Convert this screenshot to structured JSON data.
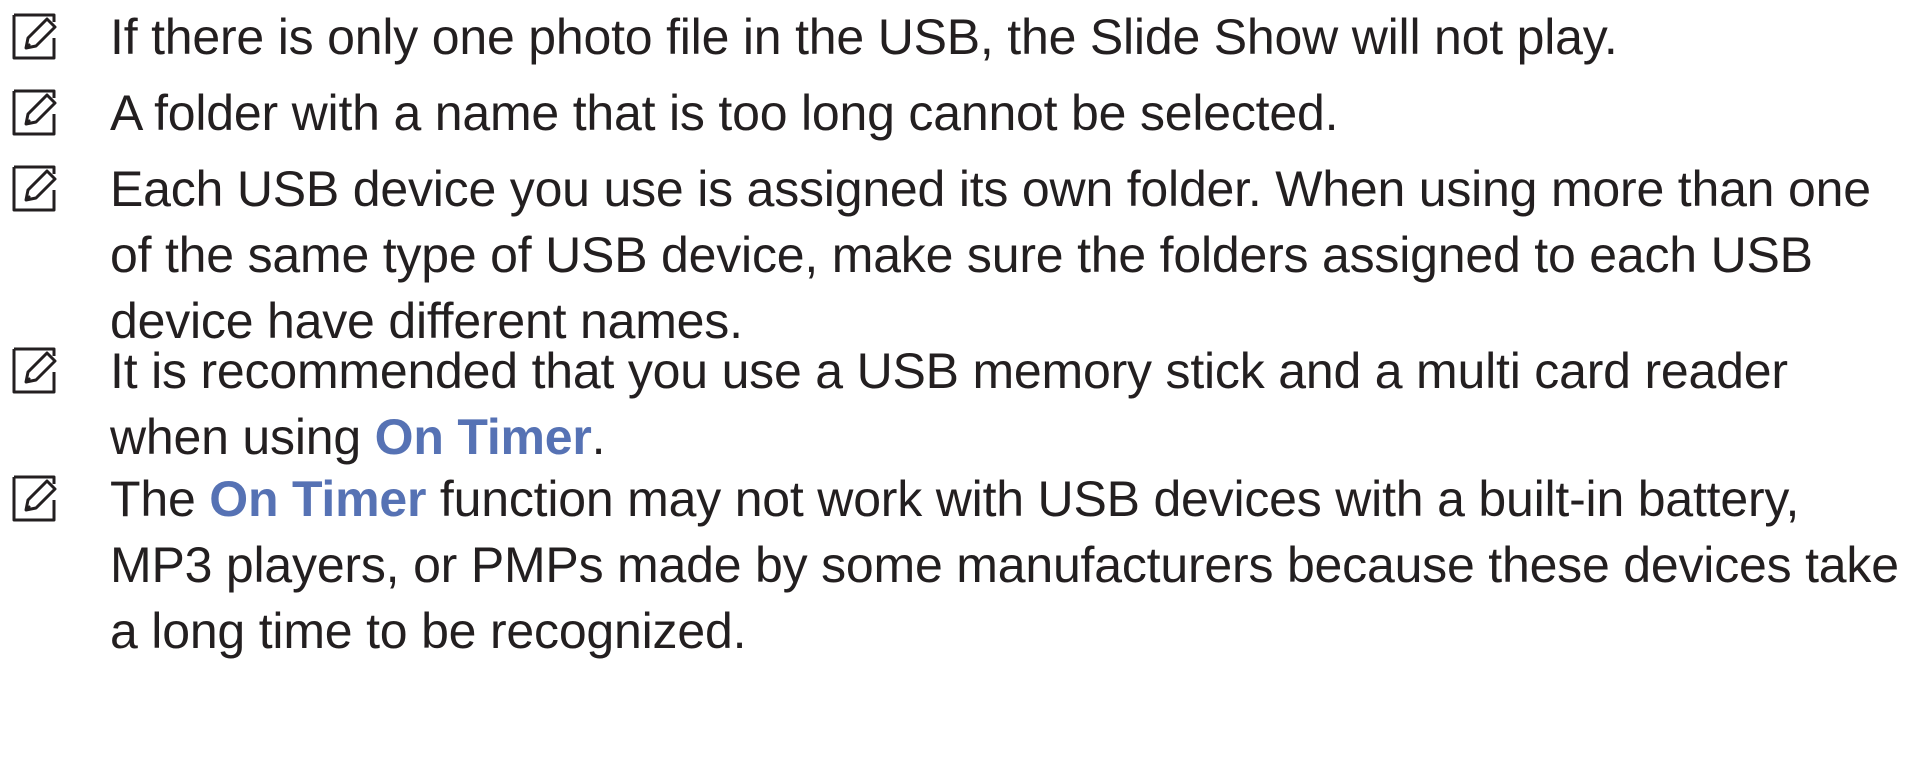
{
  "icons": {
    "note": "note-pencil-icon"
  },
  "colors": {
    "text": "#231f20",
    "highlight": "#5672b4"
  },
  "notes": [
    {
      "text": "If there is only one photo file in the USB, the Slide Show will not play."
    },
    {
      "text": "A folder with a name that is too long cannot be selected."
    },
    {
      "text": "Each USB device you use is assigned its own folder. When using more than one of the same type of USB device, make sure the folders assigned to each USB device have different names."
    },
    {
      "before": "It is recommended that you use a USB memory stick and a multi card reader when using ",
      "highlight": "On Timer",
      "after": "."
    },
    {
      "before": "The ",
      "highlight": "On Timer",
      "after": " function may not work with USB devices with a built-in battery, MP3 players, or PMPs made by some manufacturers because these devices take a long time to be recognized."
    }
  ]
}
